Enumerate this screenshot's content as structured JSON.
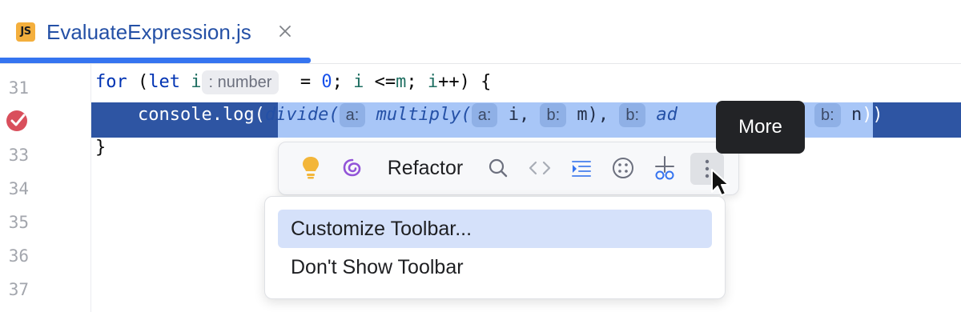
{
  "tab": {
    "icon_text": "JS",
    "title": "EvaluateExpression.js"
  },
  "gutter": {
    "line_numbers": [
      "31",
      "",
      "33",
      "34",
      "35",
      "36",
      "37"
    ]
  },
  "code": {
    "line31": {
      "kw_for": "for",
      "open": " (",
      "kw_let": "let",
      "space": " ",
      "var_i": "i",
      "type_hint": ": number",
      "assign": "  = ",
      "zero": "0",
      "semi1": "; ",
      "var_i2": "i",
      "lte": " <=",
      "var_m": "m",
      "semi2": "; ",
      "var_i3": "i",
      "inc": "++) {"
    },
    "line32": {
      "prefix": "    console.log(",
      "divide": "divide(",
      "hint_a": "a:",
      "multiply": "multiply(",
      "hint_a2": "a:",
      "arg_i": "i, ",
      "hint_b": "b:",
      "arg_m": "m), ",
      "hint_b2": "b:",
      "arg_add": "ad",
      "hint_b3": "b:",
      "arg_n": "n",
      "suffix": "))"
    },
    "line33": "}"
  },
  "toolbar": {
    "refactor_label": "Refactor",
    "icons": [
      "lightbulb-icon",
      "ai-assistant-icon",
      "search-icon",
      "code-icon",
      "reformat-icon",
      "more-options-icon",
      "debug-icon",
      "more-icon"
    ]
  },
  "tooltip": {
    "text": "More"
  },
  "menu": {
    "items": [
      {
        "label": "Customize Toolbar...",
        "selected": true
      },
      {
        "label": "Don't Show Toolbar",
        "selected": false
      }
    ]
  },
  "colors": {
    "accent": "#3574f0",
    "selection_row": "#2e55a3",
    "selection_text": "#a8c6f7",
    "breakpoint": "#d94f5c",
    "js_icon": "#f4af3d"
  }
}
